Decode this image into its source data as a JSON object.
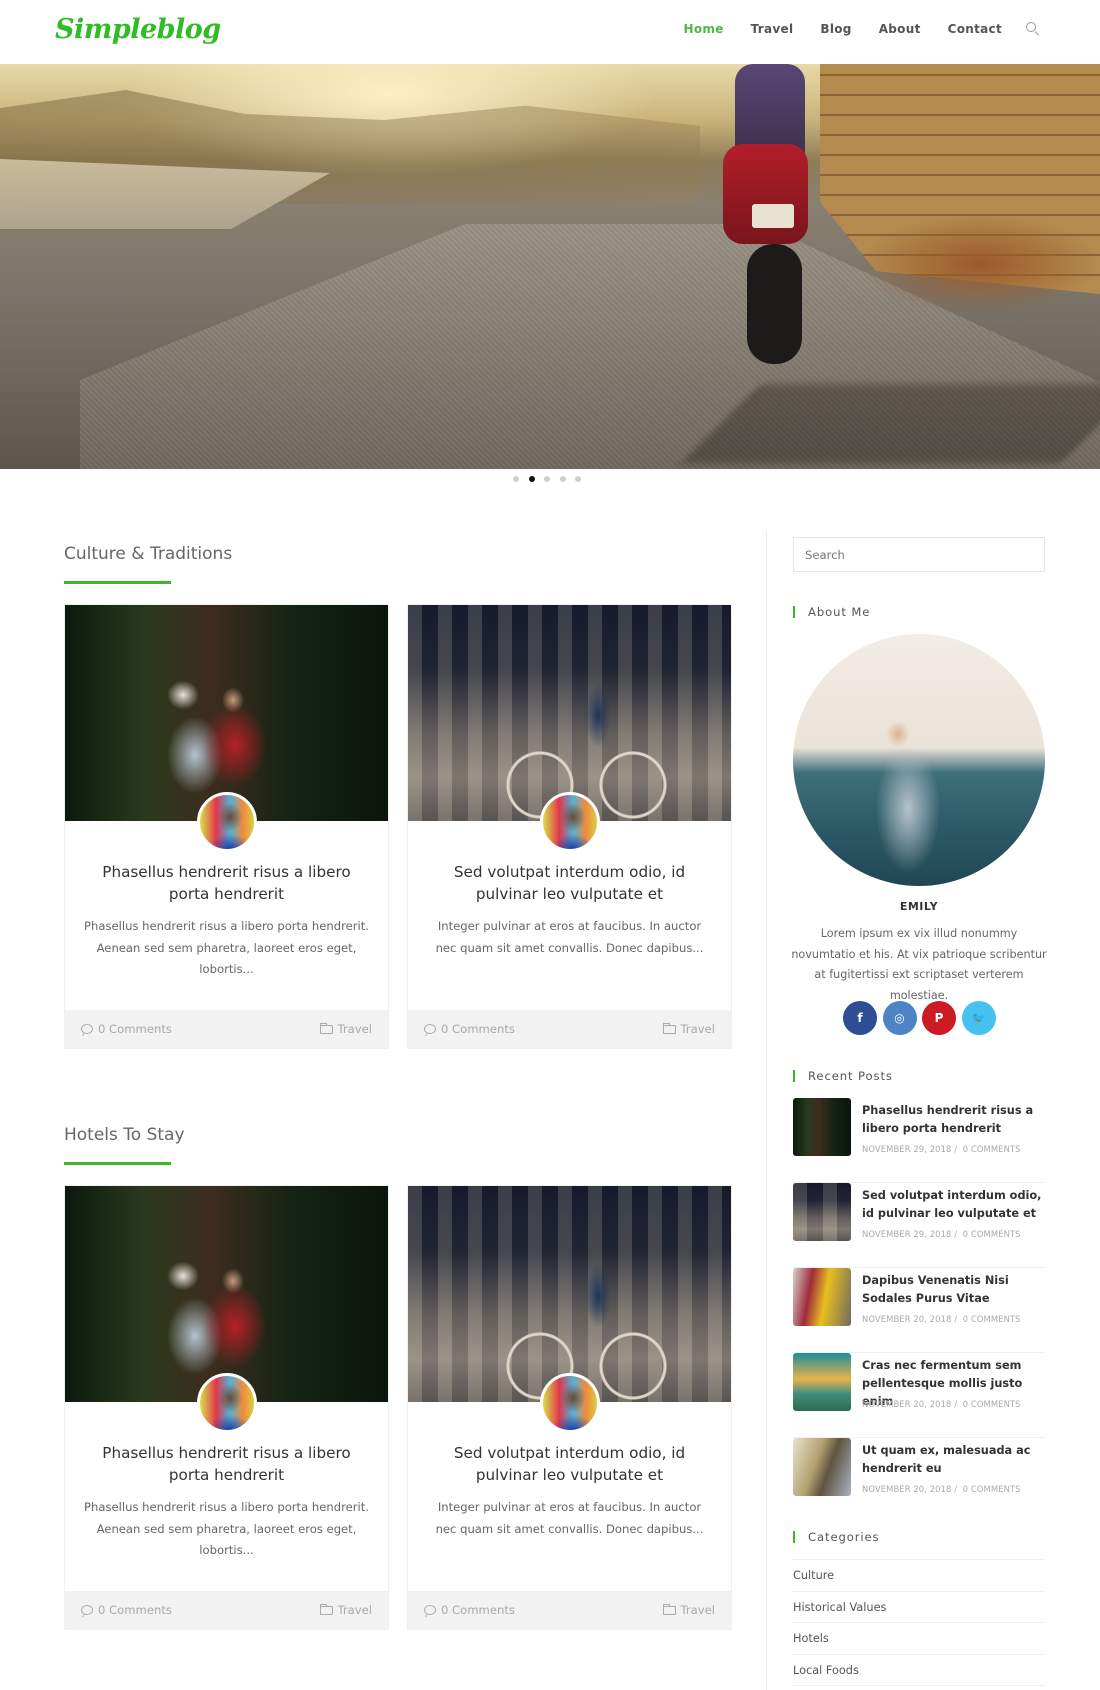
{
  "header": {
    "logo": "Simpleblog",
    "nav": [
      {
        "label": "Home",
        "active": true
      },
      {
        "label": "Travel",
        "active": false
      },
      {
        "label": "Blog",
        "active": false
      },
      {
        "label": "About",
        "active": false
      },
      {
        "label": "Contact",
        "active": false
      }
    ],
    "search_icon": "search-icon"
  },
  "slider": {
    "dot_count": 5,
    "active_dot": 2
  },
  "sections": [
    {
      "title": "Culture & Traditions",
      "posts": [
        {
          "title": "Phasellus hendrerit risus a libero porta hendrerit",
          "excerpt": "Phasellus hendrerit risus a libero porta hendrerit. Aenean sed sem pharetra, laoreet eros eget, lobortis...",
          "comments": "0 Comments",
          "category": "Travel"
        },
        {
          "title": "Sed volutpat interdum odio, id pulvinar leo vulputate et",
          "excerpt": "Integer pulvinar at eros at faucibus. In auctor nec quam sit amet convallis. Donec dapibus...",
          "comments": "0 Comments",
          "category": "Travel"
        }
      ]
    },
    {
      "title": "Hotels To Stay",
      "posts": [
        {
          "title": "Phasellus hendrerit risus a libero porta hendrerit",
          "excerpt": "Phasellus hendrerit risus a libero porta hendrerit. Aenean sed sem pharetra, laoreet eros eget, lobortis...",
          "comments": "0 Comments",
          "category": "Travel"
        },
        {
          "title": "Sed volutpat interdum odio, id pulvinar leo vulputate et",
          "excerpt": "Integer pulvinar at eros at faucibus. In auctor nec quam sit amet convallis. Donec dapibus...",
          "comments": "0 Comments",
          "category": "Travel"
        }
      ]
    }
  ],
  "sidebar": {
    "search_placeholder": "Search",
    "about": {
      "title": "About Me",
      "name": "EMILY",
      "text": "Lorem ipsum ex vix illud nonummy novumtatio et his. At vix patrioque scribentur at fugitertissi ext scriptaset verterem molestiae.",
      "socials": [
        {
          "name": "facebook",
          "glyph": "f",
          "color": "#2d4e95"
        },
        {
          "name": "instagram",
          "glyph": "◎",
          "color": "#4f84c4"
        },
        {
          "name": "pinterest",
          "glyph": "P",
          "color": "#cd1b26"
        },
        {
          "name": "twitter",
          "glyph": "🐦",
          "color": "#46c1f0"
        }
      ]
    },
    "recent_posts": {
      "title": "Recent Posts",
      "items": [
        {
          "title": "Phasellus hendrerit risus a libero porta hendrerit",
          "date": "NOVEMBER 29, 2018",
          "comments": "0 COMMENTS"
        },
        {
          "title": "Sed volutpat interdum odio, id pulvinar leo vulputate et",
          "date": "NOVEMBER 29, 2018",
          "comments": "0 COMMENTS"
        },
        {
          "title": "Dapibus Venenatis Nisi Sodales Purus Vitae",
          "date": "NOVEMBER 20, 2018",
          "comments": "0 COMMENTS"
        },
        {
          "title": "Cras nec fermentum sem pellentesque mollis justo enim",
          "date": "NOVEMBER 20, 2018",
          "comments": "0 COMMENTS"
        },
        {
          "title": "Ut quam ex, malesuada ac hendrerit eu",
          "date": "NOVEMBER 20, 2018",
          "comments": "0 COMMENTS"
        }
      ]
    },
    "categories": {
      "title": "Categories",
      "items": [
        "Culture",
        "Historical Values",
        "Hotels",
        "Local Foods"
      ]
    }
  },
  "colors": {
    "brand_green": "#3ab72a",
    "nav_active": "#4cb944",
    "text_dark": "#333333",
    "footer_bg": "#f2f2f2"
  }
}
